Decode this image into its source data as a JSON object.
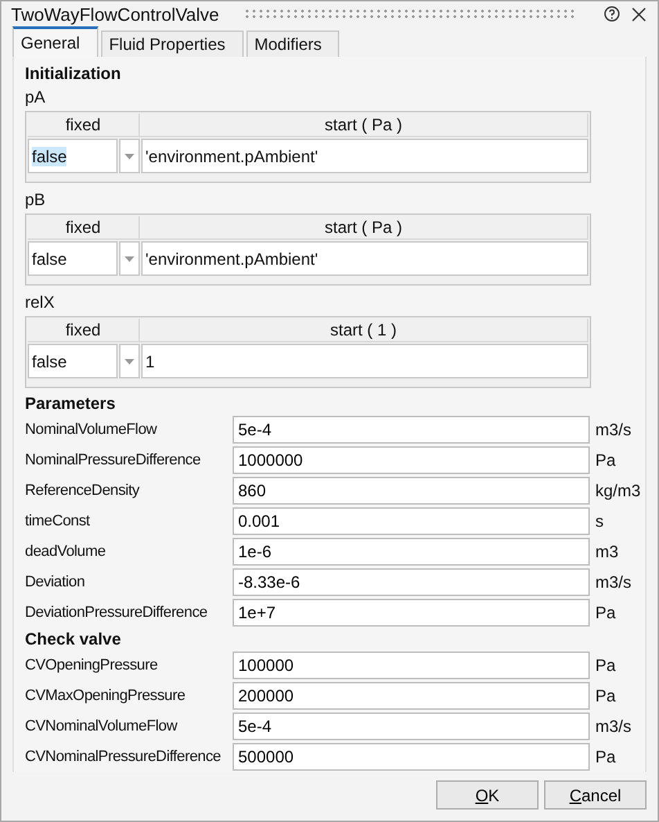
{
  "window": {
    "title": "TwoWayFlowControlValve"
  },
  "tabs": [
    {
      "label": "General",
      "selected": true
    },
    {
      "label": "Fluid Properties",
      "selected": false
    },
    {
      "label": "Modifiers",
      "selected": false
    }
  ],
  "initialization": {
    "heading": "Initialization",
    "variables": [
      {
        "name": "pA",
        "fixed_header": "fixed",
        "start_header": "start ( Pa )",
        "fixed": "false",
        "fixed_highlighted": true,
        "start": "'environment.pAmbient'"
      },
      {
        "name": "pB",
        "fixed_header": "fixed",
        "start_header": "start ( Pa )",
        "fixed": "false",
        "fixed_highlighted": false,
        "start": "'environment.pAmbient'"
      },
      {
        "name": "relX",
        "fixed_header": "fixed",
        "start_header": "start ( 1 )",
        "fixed": "false",
        "fixed_highlighted": false,
        "start": "1"
      }
    ]
  },
  "sections": [
    {
      "heading": "Parameters",
      "rows": [
        {
          "label": "NominalVolumeFlow",
          "value": "5e-4",
          "unit": "m3/s"
        },
        {
          "label": "NominalPressureDifference",
          "value": "1000000",
          "unit": "Pa"
        },
        {
          "label": "ReferenceDensity",
          "value": "860",
          "unit": "kg/m3"
        },
        {
          "label": "timeConst",
          "value": "0.001",
          "unit": "s"
        },
        {
          "label": "deadVolume",
          "value": "1e-6",
          "unit": "m3"
        },
        {
          "label": "Deviation",
          "value": "-8.33e-6",
          "unit": "m3/s"
        },
        {
          "label": "DeviationPressureDifference",
          "value": "1e+7",
          "unit": "Pa"
        }
      ]
    },
    {
      "heading": "Check valve",
      "rows": [
        {
          "label": "CVOpeningPressure",
          "value": "100000",
          "unit": "Pa"
        },
        {
          "label": "CVMaxOpeningPressure",
          "value": "200000",
          "unit": "Pa"
        },
        {
          "label": "CVNominalVolumeFlow",
          "value": "5e-4",
          "unit": "m3/s"
        },
        {
          "label": "CVNominalPressureDifference",
          "value": "500000",
          "unit": "Pa"
        }
      ]
    }
  ],
  "buttons": [
    "OK",
    "Cancel"
  ]
}
